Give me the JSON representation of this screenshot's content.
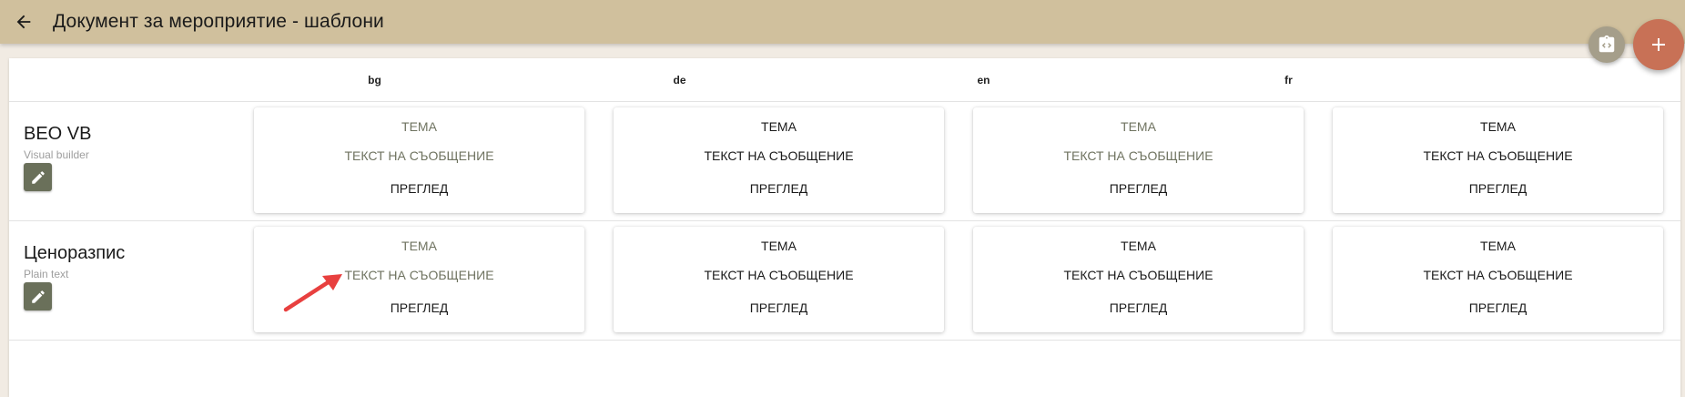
{
  "header": {
    "title": "Документ за мероприятие - шаблони"
  },
  "languages": [
    "bg",
    "de",
    "en",
    "fr"
  ],
  "card_labels": {
    "subject": "ТЕМА",
    "message_text": "ТЕКСТ НА СЪОБЩЕНИЕ",
    "preview": "ПРЕГЛЕД"
  },
  "rows": [
    {
      "title": "BEO VB",
      "subtitle": "Visual builder",
      "cards": [
        {
          "subject_filled": false,
          "text_filled": false
        },
        {
          "subject_filled": true,
          "text_filled": true
        },
        {
          "subject_filled": false,
          "text_filled": false
        },
        {
          "subject_filled": true,
          "text_filled": true
        }
      ]
    },
    {
      "title": "Ценоразпис",
      "subtitle": "Plain text",
      "cards": [
        {
          "subject_filled": false,
          "text_filled": false
        },
        {
          "subject_filled": true,
          "text_filled": true
        },
        {
          "subject_filled": true,
          "text_filled": true
        },
        {
          "subject_filled": true,
          "text_filled": true
        }
      ]
    }
  ],
  "colors": {
    "topbar": "#d0c09d",
    "fab_primary": "#c87156",
    "fab_secondary": "#a59e8a",
    "edit_button": "#6a705a",
    "muted_text": "#6f7360",
    "annotation_arrow": "#e8403f"
  },
  "icons": {
    "back": "arrow-left-icon",
    "fab_secondary": "code-clipboard-icon",
    "fab_primary": "plus-icon",
    "edit": "pencil-icon"
  }
}
